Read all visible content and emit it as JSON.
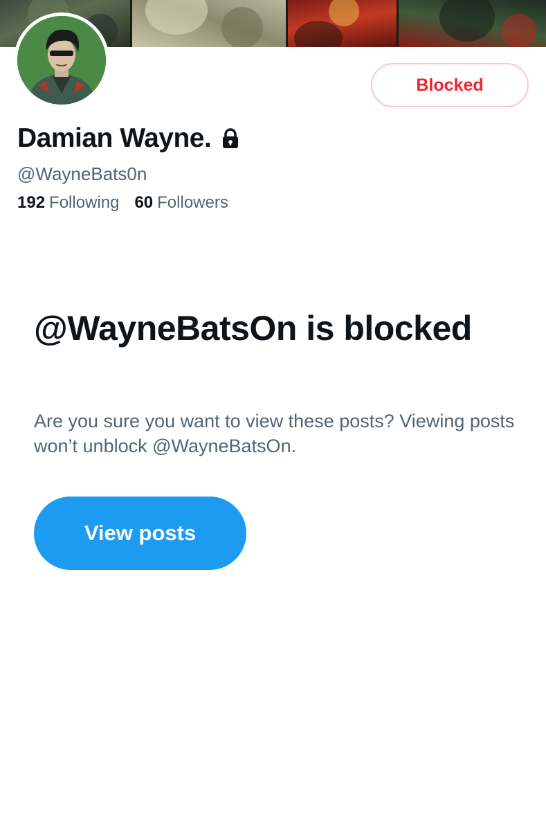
{
  "profile": {
    "display_name": "Damian Wayne.",
    "handle": "@WayneBats0n",
    "following_count": "192",
    "following_label": "Following",
    "followers_count": "60",
    "followers_label": "Followers",
    "locked": true,
    "avatar_icon": "profile-avatar",
    "banner_icon": "comic-banner"
  },
  "actions": {
    "blocked_label": "Blocked"
  },
  "blocked_notice": {
    "title": "@WayneBatsOn is blocked",
    "message": "Are you sure you want to view these posts? Viewing posts won’t unblock @WayneBatsOn.",
    "button_label": "View posts"
  },
  "colors": {
    "accent_blue": "#1d9bf0",
    "blocked_red": "#f4212e",
    "secondary_text": "#536471",
    "primary_text": "#0f1419"
  }
}
